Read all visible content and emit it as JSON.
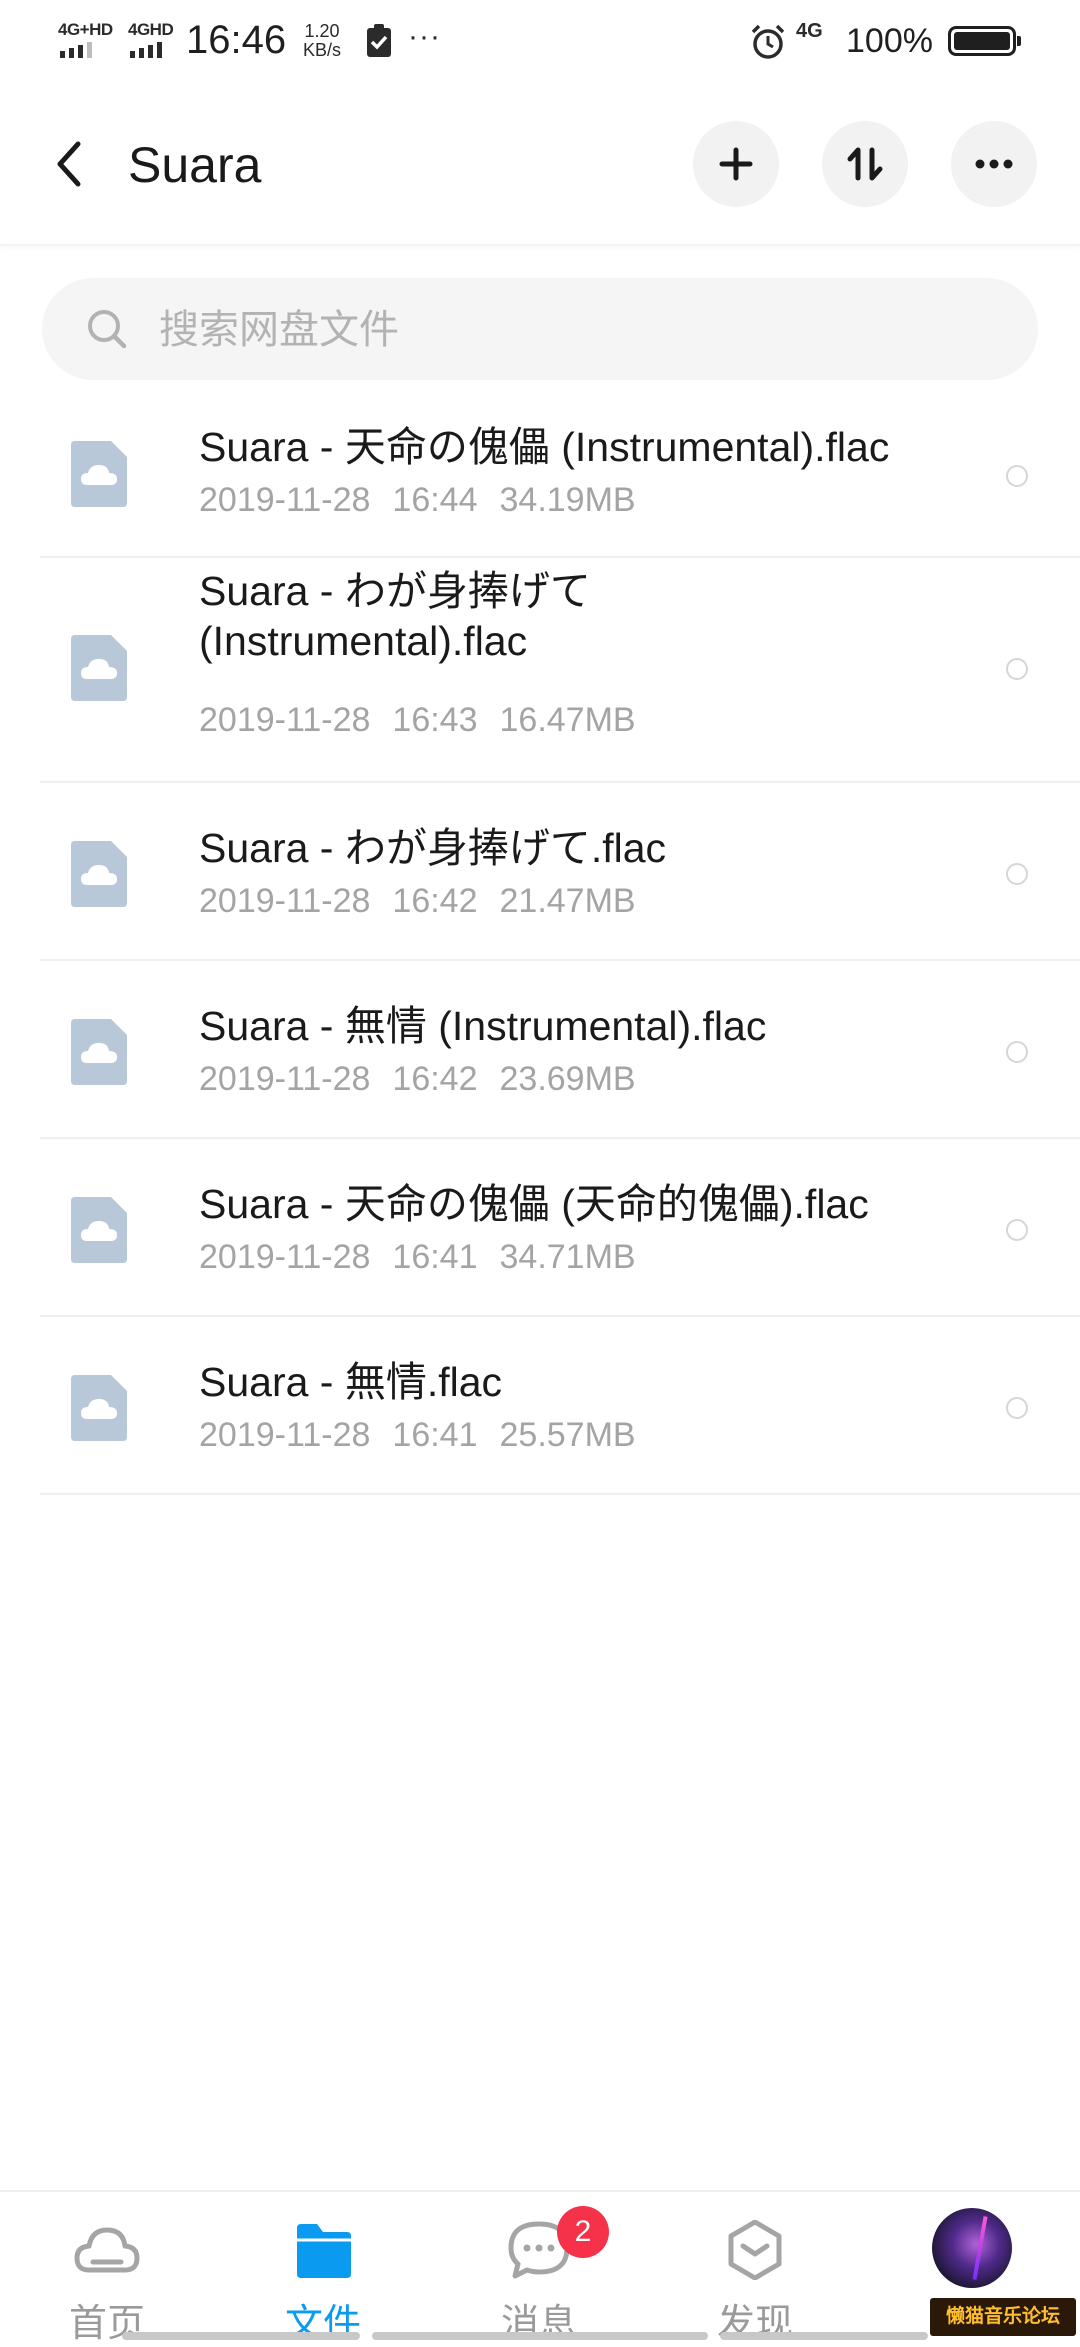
{
  "status_bar": {
    "sim1_label": "4G+HD",
    "sim2_label": "4GHD",
    "time": "16:46",
    "speed_value": "1.20",
    "speed_unit": "KB/s",
    "more": "···",
    "network": "4G",
    "battery": "100%"
  },
  "header": {
    "title": "Suara"
  },
  "search": {
    "placeholder": "搜索网盘文件"
  },
  "files": [
    {
      "name": "Suara - 天命の傀儡 (Instrumental).flac",
      "date": "2019-11-28",
      "time": "16:44",
      "size": "34.19MB"
    },
    {
      "name": "Suara - わが身捧げて (Instrumental).flac",
      "date": "2019-11-28",
      "time": "16:43",
      "size": "16.47MB"
    },
    {
      "name": "Suara - わが身捧げて.flac",
      "date": "2019-11-28",
      "time": "16:42",
      "size": "21.47MB"
    },
    {
      "name": "Suara - 無情 (Instrumental).flac",
      "date": "2019-11-28",
      "time": "16:42",
      "size": "23.69MB"
    },
    {
      "name": "Suara - 天命の傀儡 (天命的傀儡).flac",
      "date": "2019-11-28",
      "time": "16:41",
      "size": "34.71MB"
    },
    {
      "name": "Suara - 無情.flac",
      "date": "2019-11-28",
      "time": "16:41",
      "size": "25.57MB"
    }
  ],
  "bottom_nav": {
    "items": [
      {
        "label": "首页",
        "icon": "cloud-home-icon"
      },
      {
        "label": "文件",
        "icon": "folder-icon"
      },
      {
        "label": "消息",
        "icon": "chat-bubble-icon"
      },
      {
        "label": "发现",
        "icon": "discover-hexagon-icon"
      }
    ],
    "message_badge": "2"
  },
  "watermark": "懒猫音乐论坛",
  "colors": {
    "accent": "#0a9bf0",
    "badge": "#f6324a",
    "file_icon": "#b8c8d8"
  }
}
